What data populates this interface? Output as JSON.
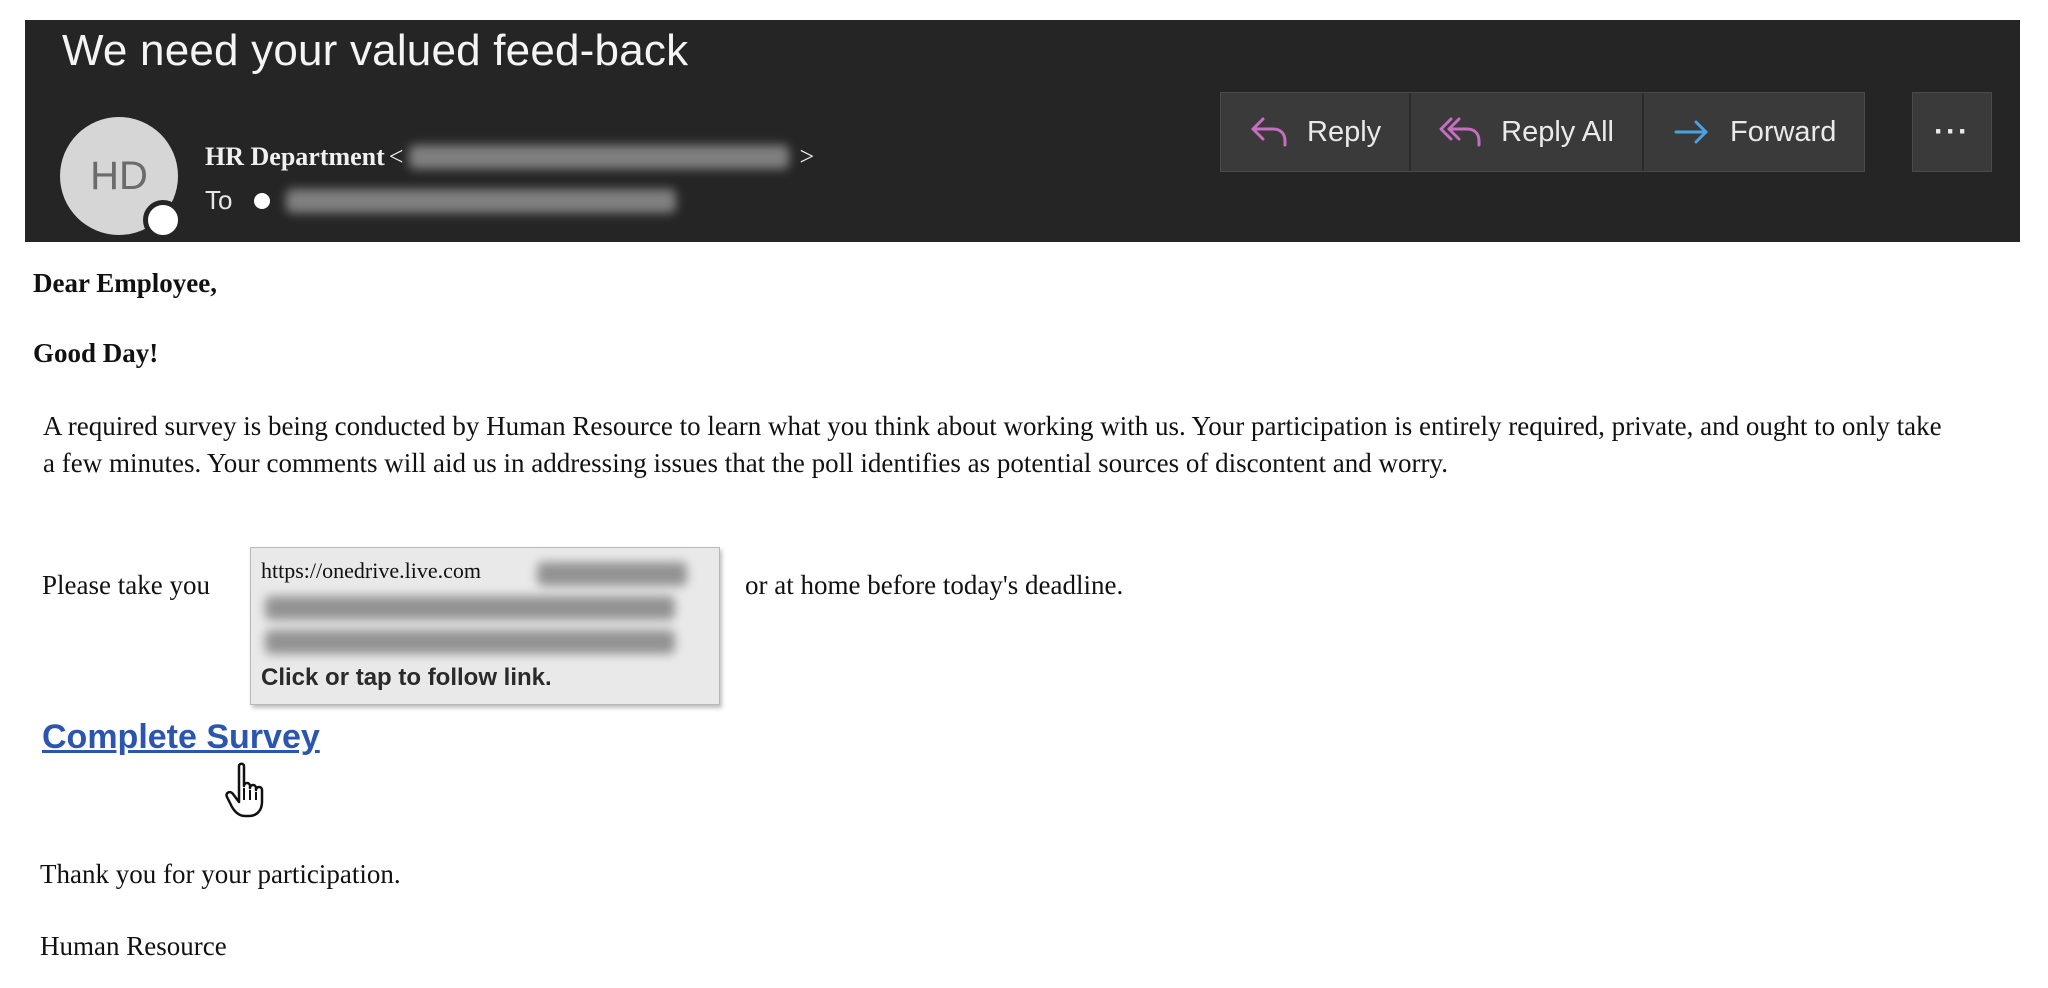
{
  "email": {
    "subject": "We need your valued feed-back",
    "avatar_initials": "HD",
    "sender_name": "HR Department",
    "sender_open": "<",
    "sender_close": ">",
    "to_label": "To"
  },
  "actions": {
    "reply": "Reply",
    "reply_all": "Reply All",
    "forward": "Forward",
    "more": "···"
  },
  "body": {
    "greeting": "Dear Employee,",
    "good_day": "Good Day!",
    "paragraph": "A required survey is being conducted by Human Resource to learn what you think about working with us. Your participation is entirely required, private, and ought to only take a few minutes. Your comments will aid us in addressing issues that the poll identifies as potential sources of discontent and worry.",
    "take_pre": "Please take you",
    "take_post": "or at home before today's deadline.",
    "link_text": "Complete Survey",
    "thanks": "Thank you for your participation.",
    "signature": "Human Resource"
  },
  "tooltip": {
    "url": "https://onedrive.live.com",
    "follow": "Click or tap to follow link."
  },
  "colors": {
    "header_bg": "#252525",
    "action_bg": "#3a3a3a",
    "reply_icon": "#c46fc0",
    "forward_icon": "#4aa3e0",
    "link": "#2a56b0"
  },
  "icons": {
    "reply": "reply-arrow-icon",
    "reply_all": "reply-all-arrow-icon",
    "forward": "forward-arrow-icon",
    "more": "ellipsis-icon",
    "cursor": "hand-pointer-icon"
  }
}
